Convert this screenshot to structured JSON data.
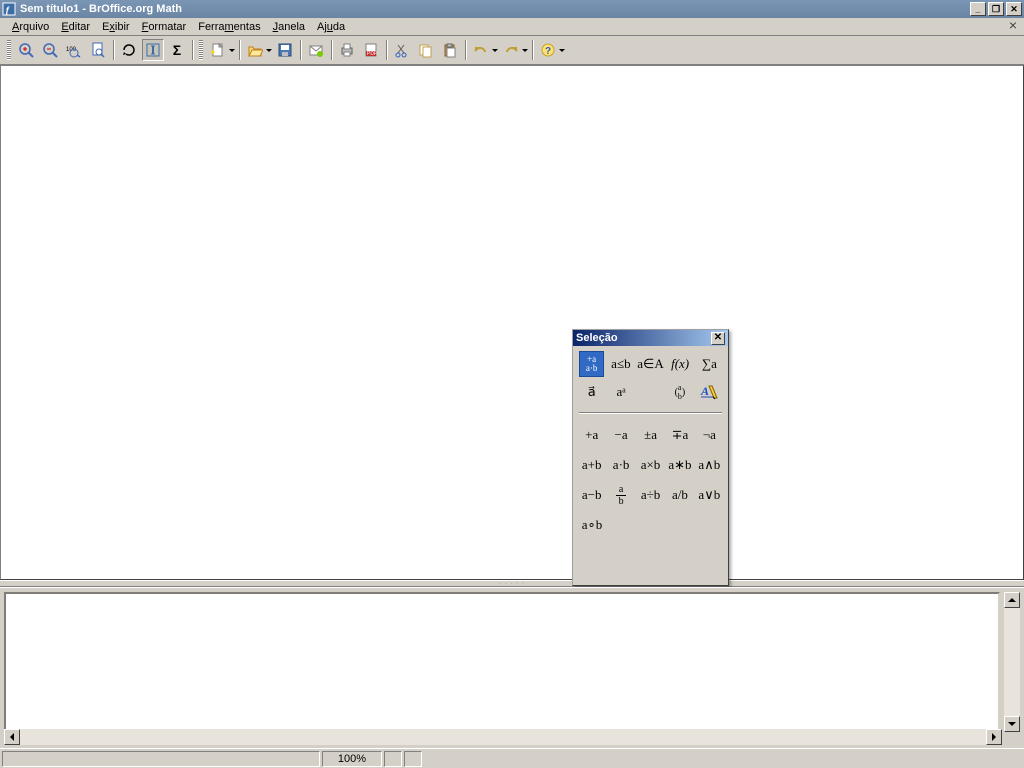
{
  "window": {
    "title": "Sem título1 - BrOffice.org Math"
  },
  "menus": {
    "file": "Arquivo",
    "edit": "Editar",
    "view": "Exibir",
    "format": "Formatar",
    "tools": "Ferramentas",
    "window": "Janela",
    "help": "Ajuda"
  },
  "palette": {
    "title": "Seleção",
    "cat": {
      "unary_binary": "+a⁄a·b",
      "relations": "a≤b",
      "set": "a∈A",
      "functions": "f(x)",
      "operators": "∑a",
      "attributes_vec": "a⃗",
      "attributes_bar": "aᵃ",
      "brackets": "(a b)",
      "formats": "A̲"
    },
    "ops": {
      "plus_a": "+a",
      "minus_a": "−a",
      "pm_a": "±a",
      "mp_a": "∓a",
      "neg_a": "¬a",
      "a_plus_b": "a+b",
      "a_dot_b": "a·b",
      "a_times_b": "a×b",
      "a_star_b": "a∗b",
      "a_and_b": "a∧b",
      "a_minus_b": "a−b",
      "a_over_b_top": "a",
      "a_over_b_bot": "b",
      "a_div_b": "a÷b",
      "a_slash_b": "a/b",
      "a_or_b": "a∨b",
      "a_circ_b": "a∘b"
    }
  },
  "status": {
    "zoom": "100%"
  },
  "icons": {
    "sigma": "Σ"
  }
}
